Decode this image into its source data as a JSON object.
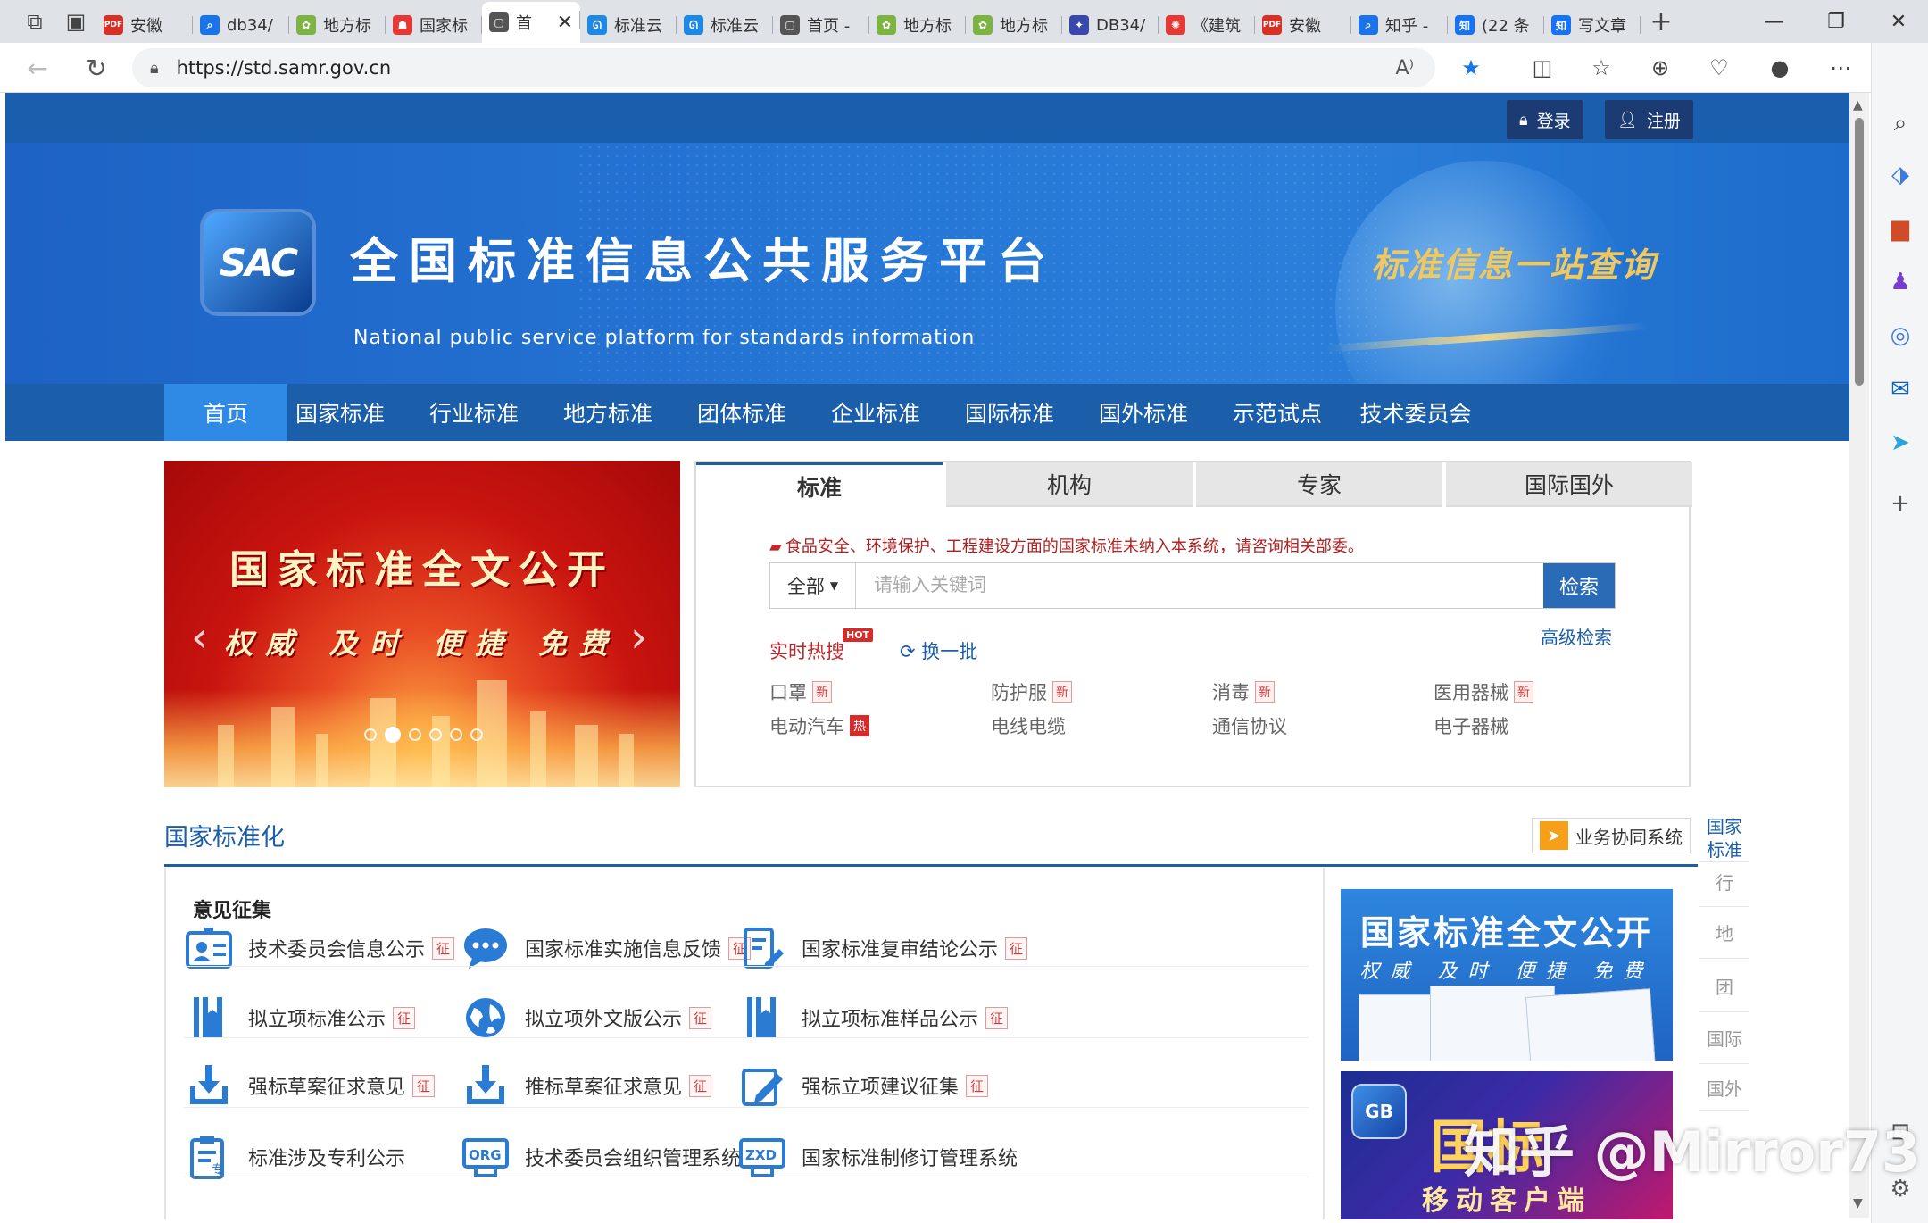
{
  "browser": {
    "tabs": [
      {
        "label": "安徽",
        "fav": "PDF",
        "color": "#d93025"
      },
      {
        "label": "db34/",
        "fav": "⌕",
        "color": "#1a73e8"
      },
      {
        "label": "地方标",
        "fav": "✿",
        "color": "#7cb342"
      },
      {
        "label": "国家标",
        "fav": "☗",
        "color": "#e53935"
      },
      {
        "label": "首",
        "fav": "▢",
        "color": "#555555",
        "active": true
      },
      {
        "label": "标准云",
        "fav": "ᘏ",
        "color": "#1e88e5"
      },
      {
        "label": "标准云",
        "fav": "ᘏ",
        "color": "#1e88e5"
      },
      {
        "label": "首页 -",
        "fav": "▢",
        "color": "#555555"
      },
      {
        "label": "地方标",
        "fav": "✿",
        "color": "#7cb342"
      },
      {
        "label": "地方标",
        "fav": "✿",
        "color": "#7cb342"
      },
      {
        "label": "DB34/",
        "fav": "✦",
        "color": "#3949ab"
      },
      {
        "label": "《建筑",
        "fav": "✺",
        "color": "#e53935"
      },
      {
        "label": "安徽",
        "fav": "PDF",
        "color": "#d93025"
      },
      {
        "label": "知乎 -",
        "fav": "⌕",
        "color": "#1a73e8"
      },
      {
        "label": "(22 条",
        "fav": "知",
        "color": "#1772f6"
      },
      {
        "label": "写文章",
        "fav": "知",
        "color": "#1772f6"
      }
    ],
    "url": "https://std.samr.gov.cn"
  },
  "header": {
    "login": "登录",
    "register": "注册",
    "logo_text": "SAC",
    "title": "全国标准信息公共服务平台",
    "subtitle": "National public service platform  for standards information",
    "slogan": "标准信息一站查询"
  },
  "nav": {
    "items": [
      "首页",
      "国家标准",
      "行业标准",
      "地方标准",
      "团体标准",
      "企业标准",
      "国际标准",
      "国外标准",
      "示范试点",
      "技术委员会"
    ]
  },
  "carousel": {
    "title": "国家标准全文公开",
    "subtitle": "权威 及时 便捷 免费",
    "active_slide": 1,
    "slide_count": 6
  },
  "search": {
    "tabs": [
      "标准",
      "机构",
      "专家",
      "国际国外"
    ],
    "notice": "食品安全、环境保护、工程建设方面的国家标准未纳入本系统，请咨询相关部委。",
    "category": "全部",
    "placeholder": "请输入关键词",
    "button": "检索",
    "advanced": "高级检索",
    "hot_label": "实时热搜",
    "hot_badge": "HOT",
    "refresh": "换一批",
    "keywords": [
      {
        "text": "口罩",
        "tag": "新",
        "type": "new"
      },
      {
        "text": "防护服",
        "tag": "新",
        "type": "new"
      },
      {
        "text": "消毒",
        "tag": "新",
        "type": "new"
      },
      {
        "text": "医用器械",
        "tag": "新",
        "type": "new"
      },
      {
        "text": "电动汽车",
        "tag": "热",
        "type": "hot"
      },
      {
        "text": "电线电缆",
        "tag": "",
        "type": ""
      },
      {
        "text": "通信协议",
        "tag": "",
        "type": ""
      },
      {
        "text": "电子器械",
        "tag": "",
        "type": ""
      }
    ]
  },
  "section": {
    "title": "国家标准化",
    "biz_system": "业务协同系统",
    "side_tabs": [
      "国家标准",
      "行",
      "地",
      "团",
      "国际",
      "国外"
    ],
    "opinion_title": "意见征集",
    "items": [
      {
        "label": "技术委员会信息公示",
        "tag": "征",
        "icon": "id-card-icon"
      },
      {
        "label": "国家标准实施信息反馈",
        "tag": "征",
        "icon": "chat-bubble-icon"
      },
      {
        "label": "国家标准复审结论公示",
        "tag": "征",
        "icon": "document-edit-icon"
      },
      {
        "label": "拟立项标准公示",
        "tag": "征",
        "icon": "book-icon"
      },
      {
        "label": "拟立项外文版公示",
        "tag": "征",
        "icon": "globe-icon"
      },
      {
        "label": "拟立项标准样品公示",
        "tag": "征",
        "icon": "book-icon"
      },
      {
        "label": "强标草案征求意见",
        "tag": "征",
        "icon": "download-tray-icon"
      },
      {
        "label": "推标草案征求意见",
        "tag": "征",
        "icon": "download-tray-icon"
      },
      {
        "label": "强标立项建议征集",
        "tag": "征",
        "icon": "pencil-edit-icon"
      },
      {
        "label": "标准涉及专利公示",
        "tag": "",
        "icon": "clipboard-icon"
      },
      {
        "label": "技术委员会组织管理系统",
        "tag": "",
        "icon": "org-icon"
      },
      {
        "label": "国家标准制修订管理系统",
        "tag": "",
        "icon": "zxd-icon"
      }
    ],
    "promo1_title": "国家标准全文公开",
    "promo1_sub": "权威 及时 便捷 免费",
    "promo2_logo": "GB",
    "promo2_big": "国标",
    "promo2_sub": "移动客户端"
  },
  "watermark": "知乎 @Mirror73",
  "colors": {
    "primary": "#1b5ea9",
    "nav_active": "#2f8ae6",
    "tag_red": "#d23b3b",
    "search_btn": "#2a6bb8"
  }
}
